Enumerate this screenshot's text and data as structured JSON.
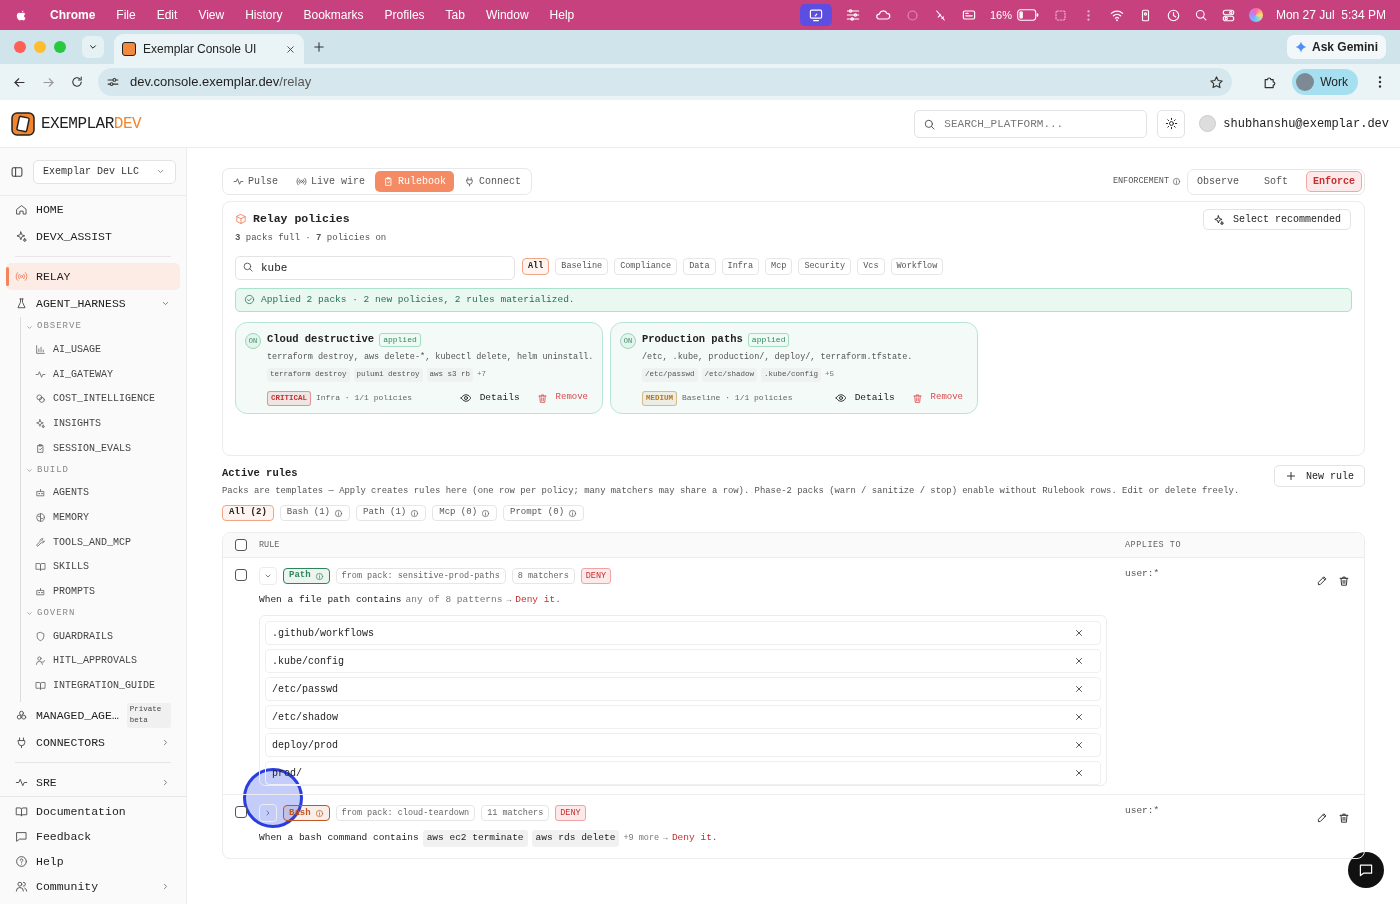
{
  "menu_bar": {
    "app": "Chrome",
    "items": [
      "File",
      "Edit",
      "View",
      "History",
      "Bookmarks",
      "Profiles",
      "Tab",
      "Window",
      "Help"
    ],
    "battery": "16%",
    "clock": "Mon 27 Jul  5:34 PM"
  },
  "browser": {
    "tab_title": "Exemplar Console UI",
    "url_host": "dev.console.exemplar.dev",
    "url_path": "/relay",
    "gemini": "Ask Gemini",
    "profile": "Work"
  },
  "header": {
    "logo_main": "EXEMPLAR",
    "logo_accent": "DEV",
    "search_placeholder": "SEARCH_PLATFORM...",
    "user": "shubhanshu@exemplar.dev"
  },
  "sidebar": {
    "org": "Exemplar Dev LLC",
    "groups": [
      [
        {
          "label": "HOME",
          "selected": false
        },
        {
          "label": "DEVX_ASSIST",
          "selected": false
        }
      ],
      [
        {
          "label": "RELAY",
          "selected": true
        },
        {
          "label": "AGENT_HARNESS",
          "selected": false,
          "expanded": true,
          "children": [
            {
              "label": "OBSERVE",
              "expanded": true,
              "children": [
                {
                  "label": "AI_USAGE",
                  "selected": false
                },
                {
                  "label": "AI_GATEWAY",
                  "selected": false
                },
                {
                  "label": "COST_INTELLIGENCE",
                  "selected": false
                },
                {
                  "label": "INSIGHTS",
                  "selected": false
                },
                {
                  "label": "SESSION_EVALS",
                  "selected": false
                }
              ]
            },
            {
              "label": "BUILD",
              "expanded": true,
              "children": [
                {
                  "label": "AGENTS",
                  "selected": false
                },
                {
                  "label": "MEMORY",
                  "selected": false
                },
                {
                  "label": "TOOLS_AND_MCP",
                  "selected": false
                },
                {
                  "label": "SKILLS",
                  "selected": false
                },
                {
                  "label": "PROMPTS",
                  "selected": false
                }
              ]
            },
            {
              "label": "GOVERN",
              "expanded": true,
              "children": [
                {
                  "label": "GUARDRAILS",
                  "selected": false
                },
                {
                  "label": "HITL_APPROVALS",
                  "selected": false
                },
                {
                  "label": "INTEGRATION_GUIDE",
                  "selected": false
                }
              ]
            }
          ]
        },
        {
          "label": "MANAGED_AGE…",
          "selected": false,
          "badge": "Private beta"
        },
        {
          "label": "CONNECTORS",
          "selected": false,
          "expanded": false
        }
      ],
      [
        {
          "label": "SRE",
          "selected": false,
          "expanded": false
        }
      ]
    ],
    "footer": [
      {
        "label": "Documentation"
      },
      {
        "label": "Feedback"
      },
      {
        "label": "Help"
      },
      {
        "label": "Community",
        "expanded": false
      }
    ]
  },
  "main": {
    "tabs": [
      {
        "label": "Pulse",
        "selected": false
      },
      {
        "label": "Live wire",
        "selected": false
      },
      {
        "label": "Rulebook",
        "selected": true
      },
      {
        "label": "Connect",
        "selected": false
      }
    ],
    "enforcement": {
      "label": "ENFORCEMENT",
      "options": [
        {
          "label": "Observe",
          "selected": false
        },
        {
          "label": "Soft",
          "selected": false
        },
        {
          "label": "Enforce",
          "selected": true
        }
      ]
    },
    "policies": {
      "title": "Relay policies",
      "stats": "**3** packs full · **7** policies on",
      "select_button": "Select recommended",
      "search": {
        "value": "kube"
      },
      "filters": [
        {
          "label": "All",
          "selected": true
        },
        {
          "label": "Baseline",
          "selected": false
        },
        {
          "label": "Compliance",
          "selected": false
        },
        {
          "label": "Data",
          "selected": false
        },
        {
          "label": "Infra",
          "selected": false
        },
        {
          "label": "Mcp",
          "selected": false
        },
        {
          "label": "Security",
          "selected": false
        },
        {
          "label": "Vcs",
          "selected": false
        },
        {
          "label": "Workflow",
          "selected": false
        }
      ],
      "notice": "Applied 2 packs · 2 new policies, 2 rules materialized.",
      "packs": [
        {
          "state": "ON",
          "title": "Cloud destructive",
          "status": "applied",
          "description": "terraform destroy, aws delete-*, kubectl delete, helm uninstall.",
          "tags": [
            "terraform destroy",
            "pulumi destroy",
            "aws s3 rb"
          ],
          "more": "+7",
          "severity": "CRITICAL",
          "color": "#c62f2f",
          "meta": "Infra · 1/1 policies",
          "details": "Details",
          "remove": "Remove"
        },
        {
          "state": "ON",
          "title": "Production paths",
          "status": "applied",
          "description": "/etc, .kube, production/, deploy/, terraform.tfstate.",
          "tags": [
            "/etc/passwd",
            "/etc/shadow",
            ".kube/config"
          ],
          "more": "+5",
          "severity": "MEDIUM",
          "color": "#b7791f",
          "meta": "Baseline · 1/1 policies",
          "details": "Details",
          "remove": "Remove"
        }
      ]
    },
    "active_rules": {
      "title": "Active rules",
      "description": "Packs are templates — Apply creates rules here (one row per policy; many matchers may share a row). Phase-2 packs (warn / sanitize / stop) enable without Rulebook rows. Edit or delete freely.",
      "new_button": "New rule",
      "filters": [
        {
          "label": "All (2)",
          "selected": true,
          "info": false
        },
        {
          "label": "Bash (1)",
          "selected": false,
          "info": true
        },
        {
          "label": "Path (1)",
          "selected": false,
          "info": true
        },
        {
          "label": "Mcp (0)",
          "selected": false,
          "info": true
        },
        {
          "label": "Prompt (0)",
          "selected": false,
          "info": true
        }
      ],
      "table": {
        "select_all_checked": false,
        "columns": [
          "RULE",
          "APPLIES TO"
        ],
        "rows": [
          {
            "checked": false,
            "expanded": true,
            "type": "Path",
            "color": "#2f855a",
            "source": "from pack: sensitive-prod-paths",
            "matchers": "8 matchers",
            "action": "DENY",
            "condition": "When a file path contains",
            "detail": "any of 8 patterns",
            "arrow": "→",
            "outcome": "Deny it.",
            "patterns": [
              ".github/workflows",
              ".kube/config",
              "/etc/passwd",
              "/etc/shadow",
              "deploy/prod",
              "prod/"
            ],
            "applies_to": "user:*"
          },
          {
            "checked": false,
            "expanded": false,
            "type": "Bash",
            "color": "#c05621",
            "source": "from pack: cloud-teardown",
            "matchers": "11 matchers",
            "action": "DENY",
            "condition": "When a bash command contains",
            "commands": [
              "aws ec2 terminate",
              "aws rds delete"
            ],
            "more": "+9 more",
            "arrow": "→",
            "outcome": "Deny it.",
            "applies_to": "user:*"
          }
        ]
      }
    }
  }
}
